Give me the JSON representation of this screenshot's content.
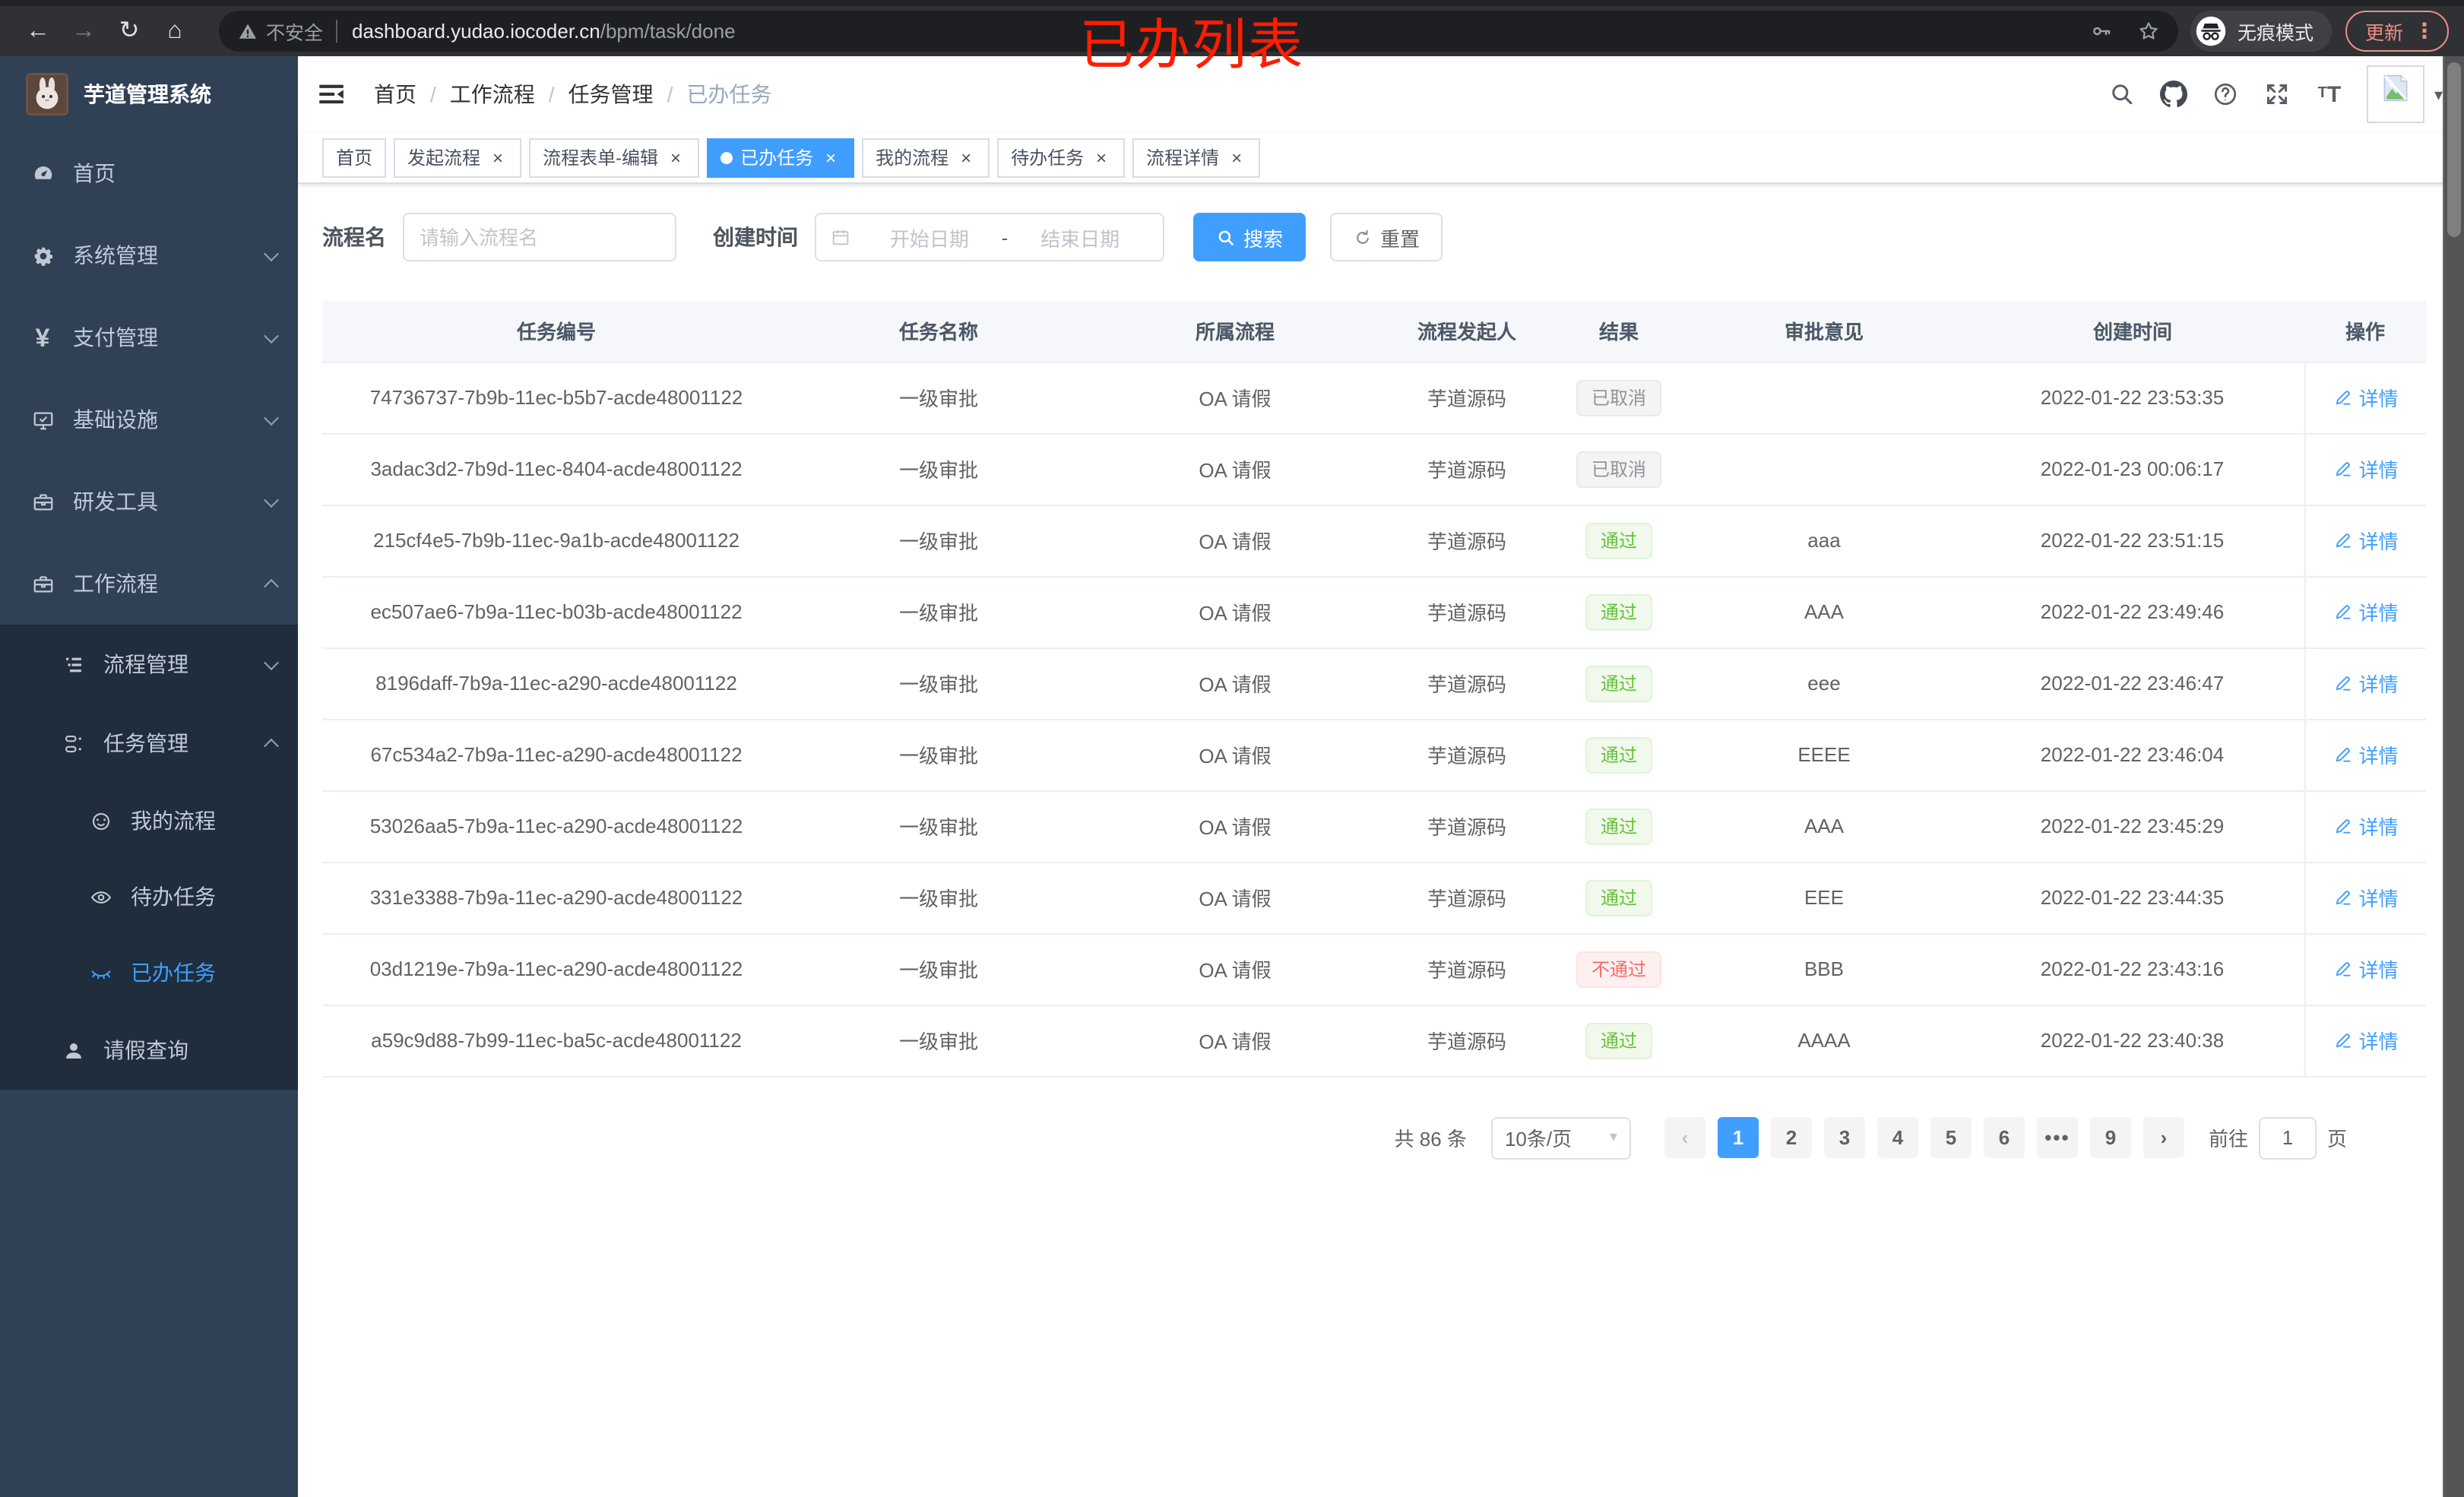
{
  "chrome": {
    "security": "不安全",
    "url_host": "dashboard.yudao.iocoder.cn",
    "url_path": "/bpm/task/done",
    "incognito": "无痕模式",
    "update": "更新",
    "annotation": "已办列表"
  },
  "icons": {
    "back": "←",
    "forward": "→",
    "reload": "↻",
    "home": "⌂",
    "close": "×",
    "prev": "‹",
    "next": "›",
    "menu_dots": "⋮",
    "caret_down": "▾"
  },
  "sidebar": {
    "title": "芋道管理系统",
    "menu": [
      {
        "key": "home",
        "icon": "dashboard-icon",
        "label": "首页",
        "level": 1
      },
      {
        "key": "system-management",
        "icon": "gear-icon",
        "label": "系统管理",
        "level": 1,
        "arrow": "down"
      },
      {
        "key": "payment-management",
        "icon": "yen-icon",
        "label": "支付管理",
        "level": 1,
        "arrow": "down"
      },
      {
        "key": "infrastructure",
        "icon": "monitor-icon",
        "label": "基础设施",
        "level": 1,
        "arrow": "down"
      },
      {
        "key": "dev-tools",
        "icon": "toolbox-icon",
        "label": "研发工具",
        "level": 1,
        "arrow": "down"
      },
      {
        "key": "workflow",
        "icon": "briefcase-icon",
        "label": "工作流程",
        "level": 1,
        "arrow": "up"
      },
      {
        "key": "process-management",
        "icon": "flow-list-icon",
        "label": "流程管理",
        "level": 2,
        "sub": true,
        "arrow": "down"
      },
      {
        "key": "task-management",
        "icon": "org-icon",
        "label": "任务管理",
        "level": 2,
        "sub": true,
        "arrow": "up"
      },
      {
        "key": "my-process",
        "icon": "face-icon",
        "label": "我的流程",
        "level": 3,
        "sub": true
      },
      {
        "key": "todo-tasks",
        "icon": "eye-icon",
        "label": "待办任务",
        "level": 3,
        "sub": true
      },
      {
        "key": "done-tasks",
        "icon": "eye-closed-icon",
        "label": "已办任务",
        "level": 3,
        "sub": true,
        "active": true
      },
      {
        "key": "leave-query",
        "icon": "user-icon",
        "label": "请假查询",
        "level": 2,
        "sub": true
      }
    ]
  },
  "breadcrumb": [
    {
      "key": "home",
      "label": "首页",
      "sep": true
    },
    {
      "key": "workflow",
      "label": "工作流程",
      "sep": true
    },
    {
      "key": "task-management",
      "label": "任务管理",
      "sep": true
    },
    {
      "key": "done-tasks",
      "label": "已办任务",
      "current": true
    }
  ],
  "tabs": [
    {
      "key": "home",
      "label": "首页"
    },
    {
      "key": "start-process",
      "label": "发起流程",
      "closable": true
    },
    {
      "key": "form-edit",
      "label": "流程表单-编辑",
      "closable": true
    },
    {
      "key": "done-tasks",
      "label": "已办任务",
      "closable": true,
      "active": true
    },
    {
      "key": "my-process",
      "label": "我的流程",
      "closable": true
    },
    {
      "key": "todo-tasks",
      "label": "待办任务",
      "closable": true
    },
    {
      "key": "process-detail",
      "label": "流程详情",
      "closable": true
    }
  ],
  "filters": {
    "name_label": "流程名",
    "name_placeholder": "请输入流程名",
    "time_label": "创建时间",
    "start_placeholder": "开始日期",
    "range_separator": "-",
    "end_placeholder": "结束日期",
    "search_label": "搜索",
    "reset_label": "重置"
  },
  "table": {
    "columns": [
      {
        "key": "id",
        "label": "任务编号"
      },
      {
        "key": "name",
        "label": "任务名称"
      },
      {
        "key": "process",
        "label": "所属流程"
      },
      {
        "key": "starter",
        "label": "流程发起人"
      },
      {
        "key": "result",
        "label": "结果"
      },
      {
        "key": "comment",
        "label": "审批意见"
      },
      {
        "key": "created",
        "label": "创建时间"
      },
      {
        "key": "actions",
        "label": "操作"
      }
    ],
    "rows": [
      {
        "id": "74736737-7b9b-11ec-b5b7-acde48001122",
        "name": "一级审批",
        "process": "OA 请假",
        "starter": "芋道源码",
        "result": "已取消",
        "result_type": "info",
        "comment": "",
        "created": "2022-01-22 23:53:35",
        "action": "详情"
      },
      {
        "id": "3adac3d2-7b9d-11ec-8404-acde48001122",
        "name": "一级审批",
        "process": "OA 请假",
        "starter": "芋道源码",
        "result": "已取消",
        "result_type": "info",
        "comment": "",
        "created": "2022-01-23 00:06:17",
        "action": "详情"
      },
      {
        "id": "215cf4e5-7b9b-11ec-9a1b-acde48001122",
        "name": "一级审批",
        "process": "OA 请假",
        "starter": "芋道源码",
        "result": "通过",
        "result_type": "success",
        "comment": "aaa",
        "created": "2022-01-22 23:51:15",
        "action": "详情"
      },
      {
        "id": "ec507ae6-7b9a-11ec-b03b-acde48001122",
        "name": "一级审批",
        "process": "OA 请假",
        "starter": "芋道源码",
        "result": "通过",
        "result_type": "success",
        "comment": "AAA",
        "created": "2022-01-22 23:49:46",
        "action": "详情"
      },
      {
        "id": "8196daff-7b9a-11ec-a290-acde48001122",
        "name": "一级审批",
        "process": "OA 请假",
        "starter": "芋道源码",
        "result": "通过",
        "result_type": "success",
        "comment": "eee",
        "created": "2022-01-22 23:46:47",
        "action": "详情"
      },
      {
        "id": "67c534a2-7b9a-11ec-a290-acde48001122",
        "name": "一级审批",
        "process": "OA 请假",
        "starter": "芋道源码",
        "result": "通过",
        "result_type": "success",
        "comment": "EEEE",
        "created": "2022-01-22 23:46:04",
        "action": "详情"
      },
      {
        "id": "53026aa5-7b9a-11ec-a290-acde48001122",
        "name": "一级审批",
        "process": "OA 请假",
        "starter": "芋道源码",
        "result": "通过",
        "result_type": "success",
        "comment": "AAA",
        "created": "2022-01-22 23:45:29",
        "action": "详情"
      },
      {
        "id": "331e3388-7b9a-11ec-a290-acde48001122",
        "name": "一级审批",
        "process": "OA 请假",
        "starter": "芋道源码",
        "result": "通过",
        "result_type": "success",
        "comment": "EEE",
        "created": "2022-01-22 23:44:35",
        "action": "详情"
      },
      {
        "id": "03d1219e-7b9a-11ec-a290-acde48001122",
        "name": "一级审批",
        "process": "OA 请假",
        "starter": "芋道源码",
        "result": "不通过",
        "result_type": "danger",
        "comment": "BBB",
        "created": "2022-01-22 23:43:16",
        "action": "详情"
      },
      {
        "id": "a59c9d88-7b99-11ec-ba5c-acde48001122",
        "name": "一级审批",
        "process": "OA 请假",
        "starter": "芋道源码",
        "result": "通过",
        "result_type": "success",
        "comment": "AAAA",
        "created": "2022-01-22 23:40:38",
        "action": "详情"
      }
    ]
  },
  "pagination": {
    "total": "共 86 条",
    "size": "10条/页",
    "pages": [
      {
        "key": "1",
        "label": "1",
        "active": true
      },
      {
        "key": "2",
        "label": "2"
      },
      {
        "key": "3",
        "label": "3"
      },
      {
        "key": "4",
        "label": "4"
      },
      {
        "key": "5",
        "label": "5"
      },
      {
        "key": "6",
        "label": "6"
      },
      {
        "key": "more",
        "label": "•••",
        "ellipsis": true
      },
      {
        "key": "9",
        "label": "9"
      }
    ],
    "goto_label": "前往",
    "goto_value": "1",
    "goto_unit": "页"
  }
}
